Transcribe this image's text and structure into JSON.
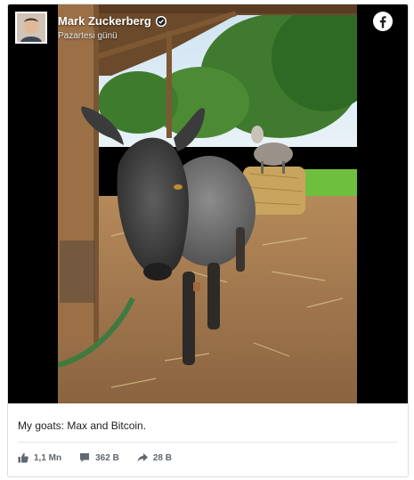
{
  "post": {
    "author": "Mark Zuckerberg",
    "date": "Pazartesi günü",
    "caption": "My goats: Max and Bitcoin.",
    "platform_icon": "facebook-logo-icon"
  },
  "stats": {
    "likes": "1,1 Mn",
    "comments": "362 B",
    "shares": "28 B"
  },
  "icons": {
    "like": "thumbs-up-icon",
    "comment": "comment-bubble-icon",
    "share": "share-arrow-icon",
    "verified": "verified-badge-icon"
  },
  "colors": {
    "facebook_blue": "#1877f2",
    "muted_text": "#606770"
  }
}
